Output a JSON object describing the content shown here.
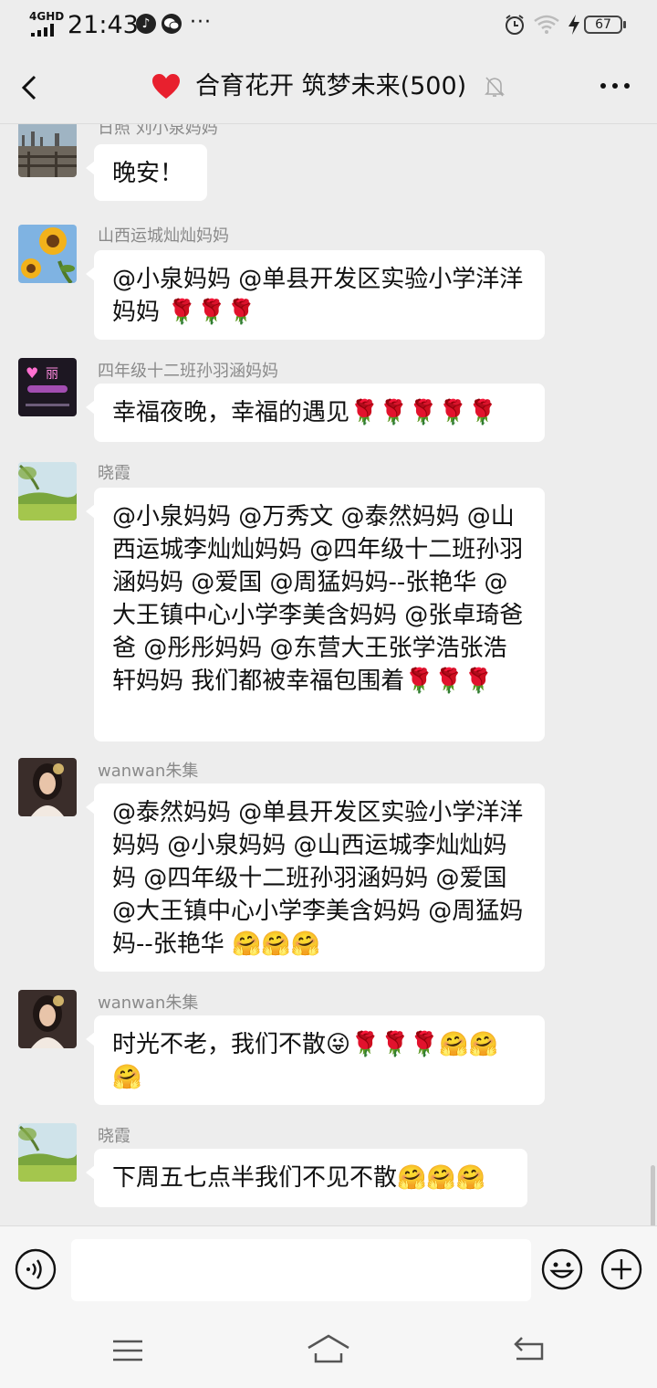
{
  "status_bar": {
    "network": "4GHD",
    "time": "21:43",
    "app_icons": [
      "music-note-icon",
      "wechat-icon"
    ],
    "more": "···",
    "battery": "67"
  },
  "header": {
    "title": "合育花开 筑梦未来(500)",
    "heart_color": "#e8202e"
  },
  "messages": [
    {
      "sender": "日照  刘小泉妈妈",
      "text": "晚安！",
      "avatar": "lakeside-avatar"
    },
    {
      "sender": "山西运城灿灿妈妈",
      "text": "@小泉妈妈 @单县开发区实验小学洋洋妈妈 🌹🌹🌹",
      "avatar": "sunflower-avatar"
    },
    {
      "sender": "四年级十二班孙羽涵妈妈",
      "text": "幸福夜晚，幸福的遇见🌹🌹🌹🌹🌹",
      "avatar": "neon-sign-avatar"
    },
    {
      "sender": "晓霞",
      "text": "@小泉妈妈 @万秀文 @泰然妈妈 @山西运城李灿灿妈妈 @四年级十二班孙羽涵妈妈 @爱国 @周猛妈妈--张艳华 @大王镇中心小学李美含妈妈 @张卓琦爸爸 @彤彤妈妈 @东营大王张学浩张浩轩妈妈  我们都被幸福包围着🌹🌹🌹",
      "avatar": "meadow-avatar"
    },
    {
      "sender": "wanwan朱集",
      "text": "@泰然妈妈 @单县开发区实验小学洋洋妈妈 @小泉妈妈 @山西运城李灿灿妈妈 @四年级十二班孙羽涵妈妈 @爱国 @大王镇中心小学李美含妈妈 @周猛妈妈--张艳华 🤗🤗🤗",
      "avatar": "girl-portrait-avatar"
    },
    {
      "sender": "wanwan朱集",
      "text": "时光不老，我们不散😜🌹🌹🌹🤗🤗🤗",
      "avatar": "girl-portrait-avatar"
    },
    {
      "sender": "晓霞",
      "text": "下周五七点半我们不见不散🤗🤗🤗",
      "avatar": "meadow-avatar"
    }
  ],
  "input_bar": {
    "value": "",
    "icons": [
      "voice-icon",
      "emoji-icon",
      "plus-icon"
    ]
  },
  "system_nav": {
    "icons": [
      "menu-icon",
      "home-icon",
      "back-icon"
    ]
  }
}
